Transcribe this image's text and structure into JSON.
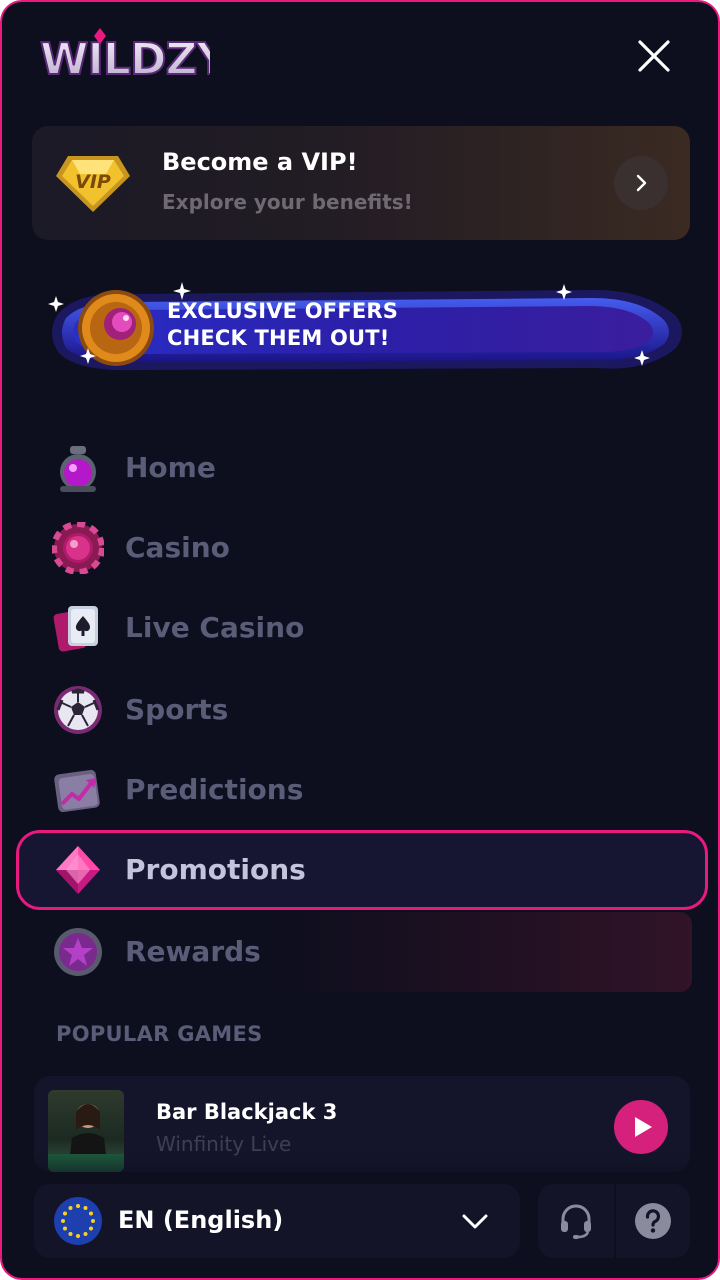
{
  "brand": {
    "logo_text": "WILDZY"
  },
  "vip": {
    "badge": "VIP",
    "title": "Become a VIP!",
    "subtitle": "Explore your benefits!"
  },
  "offers": {
    "line1": "EXCLUSIVE OFFERS",
    "line2": "CHECK THEM OUT!"
  },
  "nav": {
    "items": [
      {
        "label": "Home",
        "icon": "potion-icon"
      },
      {
        "label": "Casino",
        "icon": "casino-chip-icon"
      },
      {
        "label": "Live Casino",
        "icon": "playing-cards-icon"
      },
      {
        "label": "Sports",
        "icon": "soccer-ball-icon"
      },
      {
        "label": "Predictions",
        "icon": "trending-chart-icon"
      },
      {
        "label": "Promotions",
        "icon": "gem-icon",
        "active": true
      },
      {
        "label": "Rewards",
        "icon": "star-medal-icon"
      }
    ]
  },
  "popular": {
    "title": "POPULAR GAMES",
    "games": [
      {
        "title": "Bar Blackjack 3",
        "provider": "Winfinity Live"
      }
    ]
  },
  "footer": {
    "language": "EN (English)"
  },
  "colors": {
    "accent": "#e8197f",
    "background": "#0d0e1e",
    "nav_inactive": "#5a5c78"
  }
}
